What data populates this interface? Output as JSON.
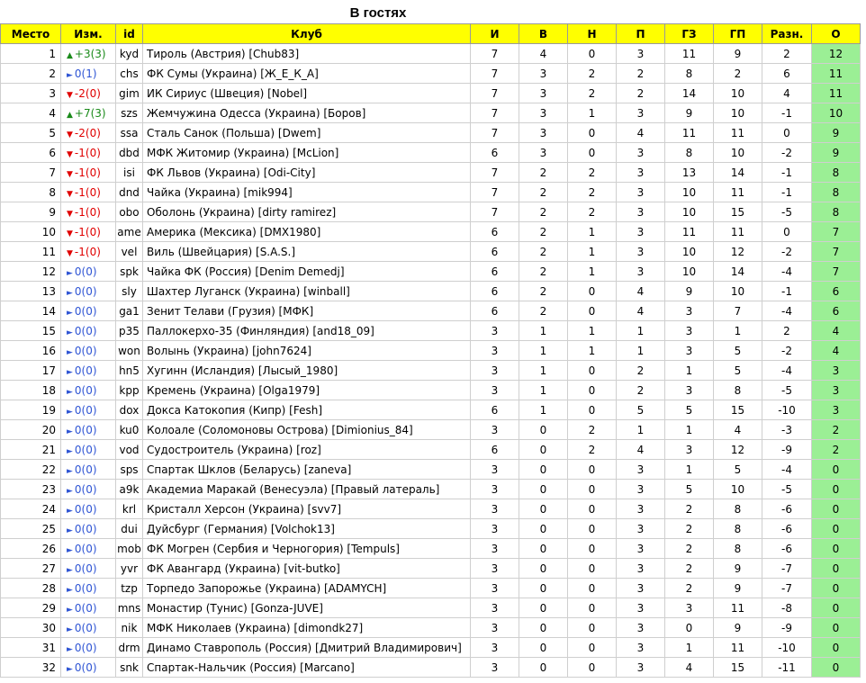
{
  "title": "В гостях",
  "colors": {
    "header_bg": "#ffff00",
    "points_bg": "#9bef95",
    "up": "#1a8a1a",
    "down": "#e00000",
    "same": "#2f55d4"
  },
  "headers": {
    "place": "Место",
    "change": "Изм.",
    "id": "id",
    "club": "Клуб",
    "games": "И",
    "wins": "В",
    "draws": "Н",
    "losses": "П",
    "gf": "ГЗ",
    "ga": "ГП",
    "diff": "Разн.",
    "pts": "О"
  },
  "rows": [
    {
      "place": "1",
      "dir": "up",
      "change": "+3(3)",
      "id": "kyd",
      "club": "Тироль (Австрия) [Chub83]",
      "games": "7",
      "wins": "4",
      "draws": "0",
      "losses": "3",
      "gf": "11",
      "ga": "9",
      "diff": "2",
      "pts": "12"
    },
    {
      "place": "2",
      "dir": "same",
      "change": "0(1)",
      "id": "chs",
      "club": "ФК Сумы (Украина) [Ж_Е_К_А]",
      "games": "7",
      "wins": "3",
      "draws": "2",
      "losses": "2",
      "gf": "8",
      "ga": "2",
      "diff": "6",
      "pts": "11"
    },
    {
      "place": "3",
      "dir": "down",
      "change": "-2(0)",
      "id": "gim",
      "club": "ИК Сириус (Швеция) [Nobel]",
      "games": "7",
      "wins": "3",
      "draws": "2",
      "losses": "2",
      "gf": "14",
      "ga": "10",
      "diff": "4",
      "pts": "11"
    },
    {
      "place": "4",
      "dir": "up",
      "change": "+7(3)",
      "id": "szs",
      "club": "Жемчужина Одесса (Украина) [Боров]",
      "games": "7",
      "wins": "3",
      "draws": "1",
      "losses": "3",
      "gf": "9",
      "ga": "10",
      "diff": "-1",
      "pts": "10"
    },
    {
      "place": "5",
      "dir": "down",
      "change": "-2(0)",
      "id": "ssa",
      "club": "Сталь Санок (Польша) [Dwem]",
      "games": "7",
      "wins": "3",
      "draws": "0",
      "losses": "4",
      "gf": "11",
      "ga": "11",
      "diff": "0",
      "pts": "9"
    },
    {
      "place": "6",
      "dir": "down",
      "change": "-1(0)",
      "id": "dbd",
      "club": "МФК Житомир (Украина) [McLion]",
      "games": "6",
      "wins": "3",
      "draws": "0",
      "losses": "3",
      "gf": "8",
      "ga": "10",
      "diff": "-2",
      "pts": "9"
    },
    {
      "place": "7",
      "dir": "down",
      "change": "-1(0)",
      "id": "isi",
      "club": "ФК Львов (Украина) [Odi-City]",
      "games": "7",
      "wins": "2",
      "draws": "2",
      "losses": "3",
      "gf": "13",
      "ga": "14",
      "diff": "-1",
      "pts": "8"
    },
    {
      "place": "8",
      "dir": "down",
      "change": "-1(0)",
      "id": "dnd",
      "club": "Чайка (Украина) [mik994]",
      "games": "7",
      "wins": "2",
      "draws": "2",
      "losses": "3",
      "gf": "10",
      "ga": "11",
      "diff": "-1",
      "pts": "8"
    },
    {
      "place": "9",
      "dir": "down",
      "change": "-1(0)",
      "id": "obo",
      "club": "Оболонь (Украина) [dirty ramirez]",
      "games": "7",
      "wins": "2",
      "draws": "2",
      "losses": "3",
      "gf": "10",
      "ga": "15",
      "diff": "-5",
      "pts": "8"
    },
    {
      "place": "10",
      "dir": "down",
      "change": "-1(0)",
      "id": "ame",
      "club": "Америка (Мексика) [DMX1980]",
      "games": "6",
      "wins": "2",
      "draws": "1",
      "losses": "3",
      "gf": "11",
      "ga": "11",
      "diff": "0",
      "pts": "7"
    },
    {
      "place": "11",
      "dir": "down",
      "change": "-1(0)",
      "id": "vel",
      "club": "Виль (Швейцария) [S.A.S.]",
      "games": "6",
      "wins": "2",
      "draws": "1",
      "losses": "3",
      "gf": "10",
      "ga": "12",
      "diff": "-2",
      "pts": "7"
    },
    {
      "place": "12",
      "dir": "same",
      "change": "0(0)",
      "id": "spk",
      "club": "Чайка ФК (Россия) [Denim Demedj]",
      "games": "6",
      "wins": "2",
      "draws": "1",
      "losses": "3",
      "gf": "10",
      "ga": "14",
      "diff": "-4",
      "pts": "7"
    },
    {
      "place": "13",
      "dir": "same",
      "change": "0(0)",
      "id": "sly",
      "club": "Шахтер Луганск (Украина) [winball]",
      "games": "6",
      "wins": "2",
      "draws": "0",
      "losses": "4",
      "gf": "9",
      "ga": "10",
      "diff": "-1",
      "pts": "6"
    },
    {
      "place": "14",
      "dir": "same",
      "change": "0(0)",
      "id": "ga1",
      "club": "Зенит Телави (Грузия) [МФК]",
      "games": "6",
      "wins": "2",
      "draws": "0",
      "losses": "4",
      "gf": "3",
      "ga": "7",
      "diff": "-4",
      "pts": "6"
    },
    {
      "place": "15",
      "dir": "same",
      "change": "0(0)",
      "id": "p35",
      "club": "Паллокерхо-35 (Финляндия) [and18_09]",
      "games": "3",
      "wins": "1",
      "draws": "1",
      "losses": "1",
      "gf": "3",
      "ga": "1",
      "diff": "2",
      "pts": "4"
    },
    {
      "place": "16",
      "dir": "same",
      "change": "0(0)",
      "id": "won",
      "club": "Волынь (Украина) [john7624]",
      "games": "3",
      "wins": "1",
      "draws": "1",
      "losses": "1",
      "gf": "3",
      "ga": "5",
      "diff": "-2",
      "pts": "4"
    },
    {
      "place": "17",
      "dir": "same",
      "change": "0(0)",
      "id": "hn5",
      "club": "Хугинн (Исландия) [Лысый_1980]",
      "games": "3",
      "wins": "1",
      "draws": "0",
      "losses": "2",
      "gf": "1",
      "ga": "5",
      "diff": "-4",
      "pts": "3"
    },
    {
      "place": "18",
      "dir": "same",
      "change": "0(0)",
      "id": "kpp",
      "club": "Кремень (Украина) [Olga1979]",
      "games": "3",
      "wins": "1",
      "draws": "0",
      "losses": "2",
      "gf": "3",
      "ga": "8",
      "diff": "-5",
      "pts": "3"
    },
    {
      "place": "19",
      "dir": "same",
      "change": "0(0)",
      "id": "dox",
      "club": "Докса Катокопия (Кипр) [Fesh]",
      "games": "6",
      "wins": "1",
      "draws": "0",
      "losses": "5",
      "gf": "5",
      "ga": "15",
      "diff": "-10",
      "pts": "3"
    },
    {
      "place": "20",
      "dir": "same",
      "change": "0(0)",
      "id": "ku0",
      "club": "Колоале (Соломоновы Острова) [Dimionius_84]",
      "games": "3",
      "wins": "0",
      "draws": "2",
      "losses": "1",
      "gf": "1",
      "ga": "4",
      "diff": "-3",
      "pts": "2"
    },
    {
      "place": "21",
      "dir": "same",
      "change": "0(0)",
      "id": "vod",
      "club": "Судостроитель (Украина) [roz]",
      "games": "6",
      "wins": "0",
      "draws": "2",
      "losses": "4",
      "gf": "3",
      "ga": "12",
      "diff": "-9",
      "pts": "2"
    },
    {
      "place": "22",
      "dir": "same",
      "change": "0(0)",
      "id": "sps",
      "club": "Спартак Шклов (Беларусь) [zaneva]",
      "games": "3",
      "wins": "0",
      "draws": "0",
      "losses": "3",
      "gf": "1",
      "ga": "5",
      "diff": "-4",
      "pts": "0"
    },
    {
      "place": "23",
      "dir": "same",
      "change": "0(0)",
      "id": "a9k",
      "club": "Академиа Маракай (Венесуэла) [Правый латераль]",
      "games": "3",
      "wins": "0",
      "draws": "0",
      "losses": "3",
      "gf": "5",
      "ga": "10",
      "diff": "-5",
      "pts": "0"
    },
    {
      "place": "24",
      "dir": "same",
      "change": "0(0)",
      "id": "krl",
      "club": "Кристалл Херсон (Украина) [svv7]",
      "games": "3",
      "wins": "0",
      "draws": "0",
      "losses": "3",
      "gf": "2",
      "ga": "8",
      "diff": "-6",
      "pts": "0"
    },
    {
      "place": "25",
      "dir": "same",
      "change": "0(0)",
      "id": "dui",
      "club": "Дуйсбург (Германия) [Volchok13]",
      "games": "3",
      "wins": "0",
      "draws": "0",
      "losses": "3",
      "gf": "2",
      "ga": "8",
      "diff": "-6",
      "pts": "0"
    },
    {
      "place": "26",
      "dir": "same",
      "change": "0(0)",
      "id": "mob",
      "club": "ФК Могрен (Сербия и Черногория) [Tempuls]",
      "games": "3",
      "wins": "0",
      "draws": "0",
      "losses": "3",
      "gf": "2",
      "ga": "8",
      "diff": "-6",
      "pts": "0"
    },
    {
      "place": "27",
      "dir": "same",
      "change": "0(0)",
      "id": "yvr",
      "club": "ФК Авангард (Украина) [vit-butko]",
      "games": "3",
      "wins": "0",
      "draws": "0",
      "losses": "3",
      "gf": "2",
      "ga": "9",
      "diff": "-7",
      "pts": "0"
    },
    {
      "place": "28",
      "dir": "same",
      "change": "0(0)",
      "id": "tzp",
      "club": "Торпедо Запорожье (Украина) [ADAMYCH]",
      "games": "3",
      "wins": "0",
      "draws": "0",
      "losses": "3",
      "gf": "2",
      "ga": "9",
      "diff": "-7",
      "pts": "0"
    },
    {
      "place": "29",
      "dir": "same",
      "change": "0(0)",
      "id": "mns",
      "club": "Монастир (Тунис) [Gonza-JUVE]",
      "games": "3",
      "wins": "0",
      "draws": "0",
      "losses": "3",
      "gf": "3",
      "ga": "11",
      "diff": "-8",
      "pts": "0"
    },
    {
      "place": "30",
      "dir": "same",
      "change": "0(0)",
      "id": "nik",
      "club": "МФК Николаев (Украина) [dimondk27]",
      "games": "3",
      "wins": "0",
      "draws": "0",
      "losses": "3",
      "gf": "0",
      "ga": "9",
      "diff": "-9",
      "pts": "0"
    },
    {
      "place": "31",
      "dir": "same",
      "change": "0(0)",
      "id": "drm",
      "club": "Динамо Ставрополь (Россия) [Дмитрий Владимирович]",
      "games": "3",
      "wins": "0",
      "draws": "0",
      "losses": "3",
      "gf": "1",
      "ga": "11",
      "diff": "-10",
      "pts": "0"
    },
    {
      "place": "32",
      "dir": "same",
      "change": "0(0)",
      "id": "snk",
      "club": "Спартак-Нальчик (Россия) [Marcano]",
      "games": "3",
      "wins": "0",
      "draws": "0",
      "losses": "3",
      "gf": "4",
      "ga": "15",
      "diff": "-11",
      "pts": "0"
    }
  ]
}
